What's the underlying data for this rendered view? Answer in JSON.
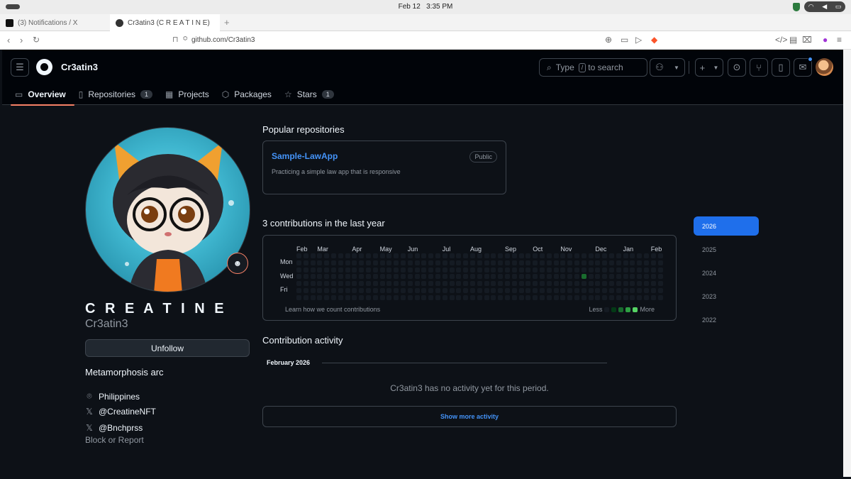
{
  "os": {
    "date": "Feb 12",
    "time": "3:35 PM"
  },
  "browser": {
    "tabs": [
      {
        "label": "(3) Notifications / X"
      },
      {
        "label": "Cr3atin3 (C R E A T I N E)"
      }
    ],
    "new_tab": "+",
    "url": "github.com/Cr3atin3"
  },
  "header": {
    "username": "Cr3atin3",
    "search_left": "Type",
    "search_key": "/",
    "search_right": "to search",
    "tabs": [
      {
        "label": "Overview",
        "icon": "book-icon"
      },
      {
        "label": "Repositories",
        "count": "1",
        "icon": "repo-icon"
      },
      {
        "label": "Projects",
        "icon": "table-icon"
      },
      {
        "label": "Packages",
        "icon": "package-icon"
      },
      {
        "label": "Stars",
        "count": "1",
        "icon": "star-icon"
      }
    ]
  },
  "profile": {
    "fullname": "C R E A T I N E",
    "login": "Cr3atin3",
    "unfollow": "Unfollow",
    "bio": "Metamorphosis arc",
    "location": "Philippines",
    "twitter1": "@CreatineNFT",
    "twitter2": "@Bnchprss",
    "block": "Block or Report"
  },
  "popular": {
    "title": "Popular repositories",
    "repo_name": "Sample-LawApp",
    "repo_visibility": "Public",
    "repo_desc": "Practicing a simple law app that is responsive"
  },
  "contributions": {
    "title": "3 contributions in the last year",
    "months": [
      "Feb",
      "Mar",
      "Apr",
      "May",
      "Jun",
      "Jul",
      "Aug",
      "Sep",
      "Oct",
      "Nov",
      "Dec",
      "Jan",
      "Feb"
    ],
    "days": [
      "Mon",
      "Wed",
      "Fri"
    ],
    "learn": "Learn how we count contributions",
    "less": "Less",
    "more": "More",
    "weeks": 53,
    "active_cells": [
      {
        "week": 41,
        "day": 3,
        "level": 2
      }
    ],
    "level_colors": [
      "#151b23",
      "#033a16",
      "#196c2e",
      "#2ea043",
      "#56d364"
    ]
  },
  "years": [
    "2026",
    "2025",
    "2024",
    "2023",
    "2022"
  ],
  "selected_year": "2026",
  "activity": {
    "title": "Contribution activity",
    "period": "February 2026",
    "empty": "Cr3atin3 has no activity yet for this period.",
    "show_more": "Show more activity"
  }
}
